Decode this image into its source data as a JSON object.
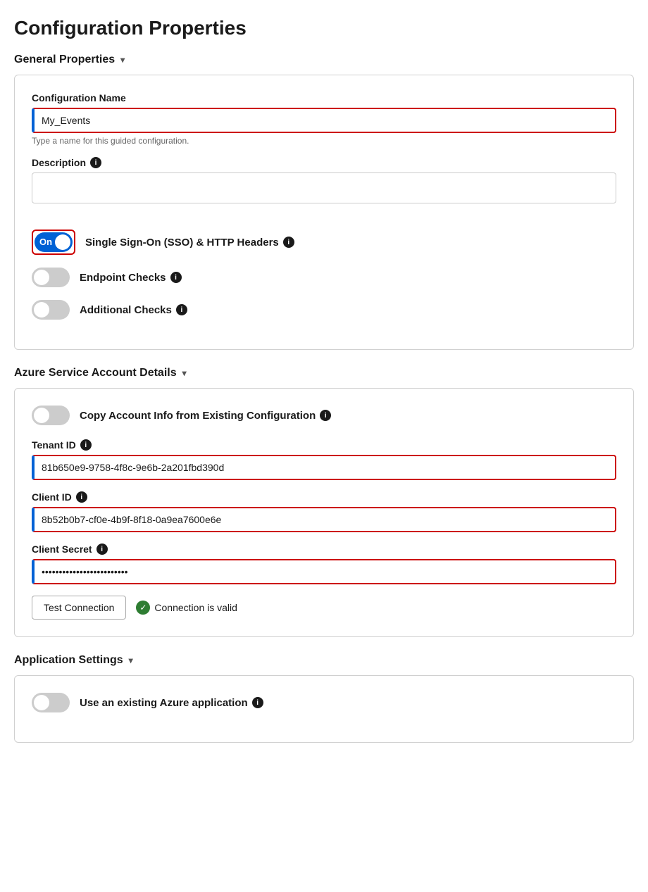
{
  "page": {
    "title": "Configuration Properties"
  },
  "general_section": {
    "header": "General Properties",
    "chevron": "▾",
    "config_name_label": "Configuration Name",
    "config_name_value": "My_Events",
    "config_name_placeholder": "My_Events",
    "config_name_hint": "Type a name for this guided configuration.",
    "description_label": "Description",
    "description_info": "i",
    "description_value": "",
    "sso_label": "Single Sign-On (SSO) & HTTP Headers",
    "sso_info": "i",
    "sso_toggle": "on",
    "sso_toggle_text": "On",
    "endpoint_label": "Endpoint Checks",
    "endpoint_info": "i",
    "endpoint_toggle": "off",
    "additional_label": "Additional Checks",
    "additional_info": "i",
    "additional_toggle": "off"
  },
  "azure_section": {
    "header": "Azure Service Account Details",
    "chevron": "▾",
    "copy_label": "Copy Account Info from Existing Configuration",
    "copy_info": "i",
    "copy_toggle": "off",
    "tenant_id_label": "Tenant ID",
    "tenant_id_info": "i",
    "tenant_id_value": "81b650e9-9758-4f8c-9e6b-2a201fbd390d",
    "client_id_label": "Client ID",
    "client_id_info": "i",
    "client_id_value": "8b52b0b7-cf0e-4b9f-8f18-0a9ea7600e6e",
    "client_secret_label": "Client Secret",
    "client_secret_info": "i",
    "client_secret_value": "••••••••••••••••••••••••••••",
    "test_btn_label": "Test Connection",
    "connection_status": "Connection is valid"
  },
  "app_section": {
    "header": "Application Settings",
    "chevron": "▾",
    "use_existing_label": "Use an existing Azure application",
    "use_existing_info": "i",
    "use_existing_toggle": "off"
  }
}
